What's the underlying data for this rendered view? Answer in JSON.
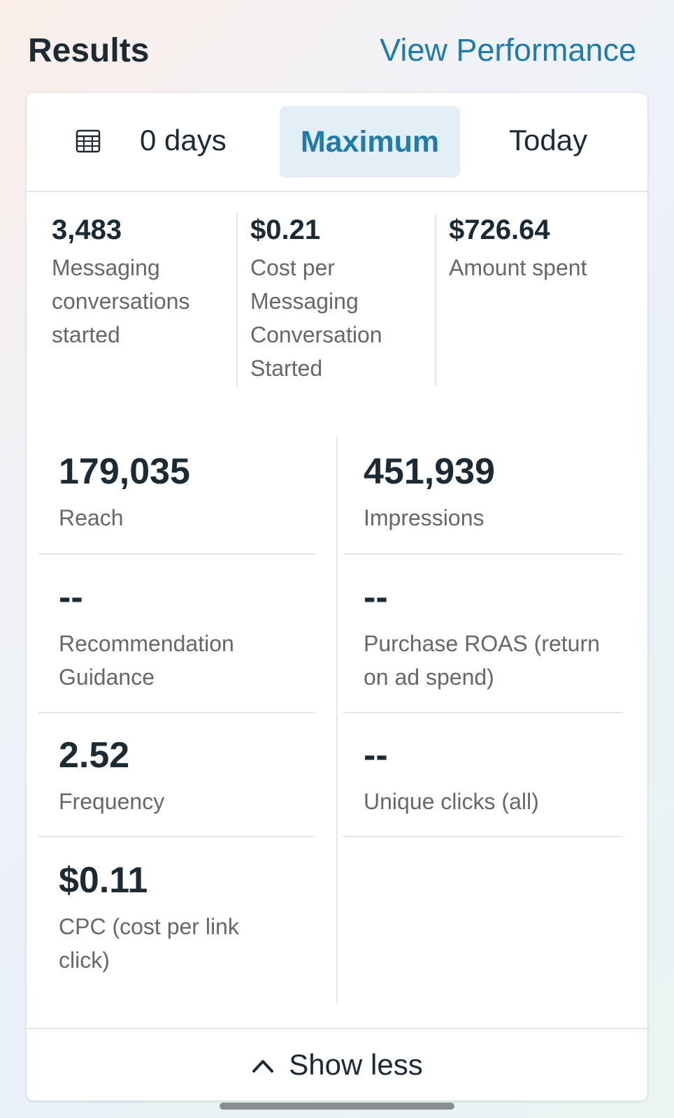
{
  "header": {
    "title": "Results",
    "link": "View Performance"
  },
  "tabs": {
    "calendar_icon": "calendar-grid-icon",
    "days": "0 days",
    "maximum": "Maximum",
    "today": "Today"
  },
  "summary": [
    {
      "value": "3,483",
      "label": "Messaging conversations started"
    },
    {
      "value": "$0.21",
      "label": "Cost per Messaging Conversation Started"
    },
    {
      "value": "$726.64",
      "label": "Amount spent"
    }
  ],
  "metrics": [
    {
      "value": "179,035",
      "label": "Reach"
    },
    {
      "value": "451,939",
      "label": "Impressions"
    },
    {
      "value": "--",
      "label": "Recommendation Guidance"
    },
    {
      "value": "--",
      "label": "Purchase ROAS (return on ad spend)"
    },
    {
      "value": "2.52",
      "label": "Frequency"
    },
    {
      "value": "--",
      "label": "Unique clicks (all)"
    },
    {
      "value": "$0.11",
      "label": "CPC (cost per link click)"
    }
  ],
  "footer": {
    "chevron_icon": "chevron-up-icon",
    "label": "Show less"
  },
  "colors": {
    "accent": "#1d7cad",
    "selected_tab_bg": "#e3eef7",
    "text_primary": "#1c2b33",
    "text_secondary": "#65676b"
  }
}
